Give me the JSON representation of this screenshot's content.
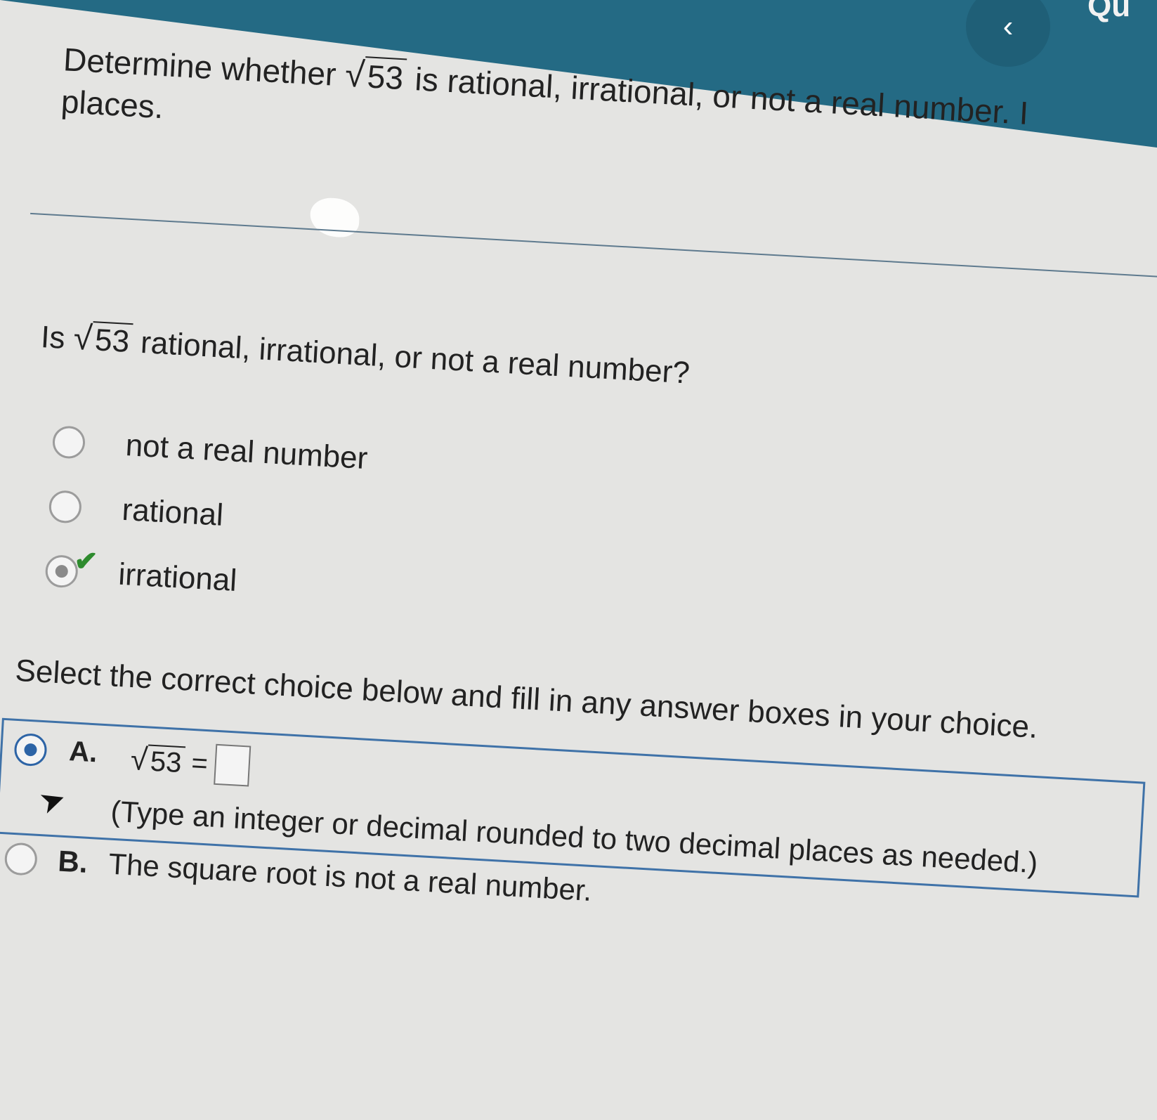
{
  "header": {
    "back_icon": "chevron-left-icon",
    "back_glyph": "‹",
    "title_fragment": "Qu",
    "prompt_start": "Determine whether",
    "radicand": "53",
    "prompt_end": "is rational, irrational, or not a real number. I",
    "prompt_line2": "places."
  },
  "question": {
    "prefix": "Is",
    "radicand": "53",
    "suffix": "rational, irrational, or not a real number?",
    "options": [
      {
        "label": "not a real number",
        "selected": false
      },
      {
        "label": "rational",
        "selected": false
      },
      {
        "label": "irrational",
        "selected": true
      }
    ],
    "check_icon": "checkmark-icon"
  },
  "part2": {
    "instruction": "Select the correct choice below and fill in any answer boxes in your choice.",
    "choice_a": {
      "letter": "A.",
      "radicand": "53",
      "equals": "=",
      "answer_value": "",
      "hint": "(Type an integer or decimal rounded to two decimal places as needed.)"
    },
    "choice_b": {
      "letter": "B.",
      "text": "The square root is not a real number."
    }
  },
  "colors": {
    "header_bar": "#246a84",
    "selection_blue": "#2d64a6",
    "check_green": "#2e8b2e"
  }
}
